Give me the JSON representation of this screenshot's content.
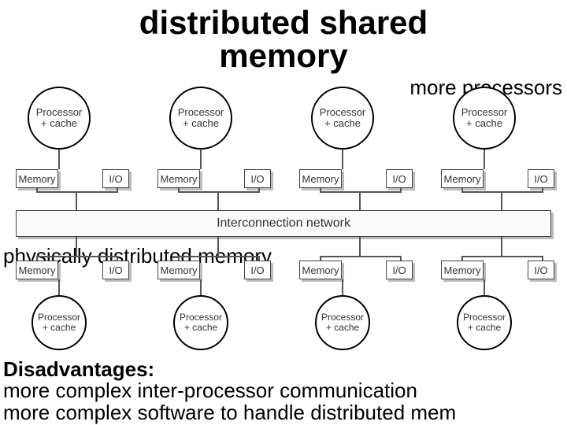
{
  "title_line1": "distributed shared",
  "title_line2": "memory",
  "annotations": {
    "more_processors": "more processors",
    "phys_dist_mem": "physically distributed memory"
  },
  "node_label1": "Processor",
  "node_label2": "+ cache",
  "mem_label": "Memory",
  "io_label": "I/O",
  "interconnect_label": "Interconnection network",
  "disadvantages": {
    "heading": "Disadvantages:",
    "line1": "more complex inter-processor communication",
    "line2": "more complex software to handle distributed mem"
  }
}
